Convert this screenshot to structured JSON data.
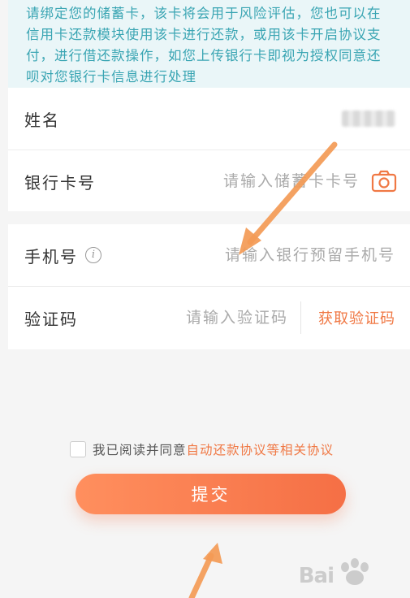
{
  "notice": {
    "text": "请绑定您的储蓄卡，该卡将会用于风险评估，您也可以在信用卡还款模块使用该卡进行还款，或用该卡开启协议支付，进行借还款操作，如您上传银行卡即视为授权同意还呗对您银行卡信息进行处理"
  },
  "form": {
    "name_label": "姓名",
    "card_label": "银行卡号",
    "card_placeholder": "请输入储蓄卡卡号",
    "phone_label": "手机号",
    "phone_placeholder": "请输入银行预留手机号",
    "code_label": "验证码",
    "code_placeholder": "请输入验证码",
    "get_code_label": "获取验证码"
  },
  "agreement": {
    "prefix": "我已阅读并同意",
    "link": "自动还款协议等相关协议",
    "checked": false
  },
  "submit_label": "提交",
  "watermark": {
    "text": "Bai"
  },
  "colors": {
    "accent": "#f07844",
    "notice_text": "#3aa5b3",
    "notice_bg": "#eaf6f8",
    "arrow": "#f39a55"
  },
  "icons": {
    "camera": "camera-icon",
    "info": "info-icon"
  }
}
